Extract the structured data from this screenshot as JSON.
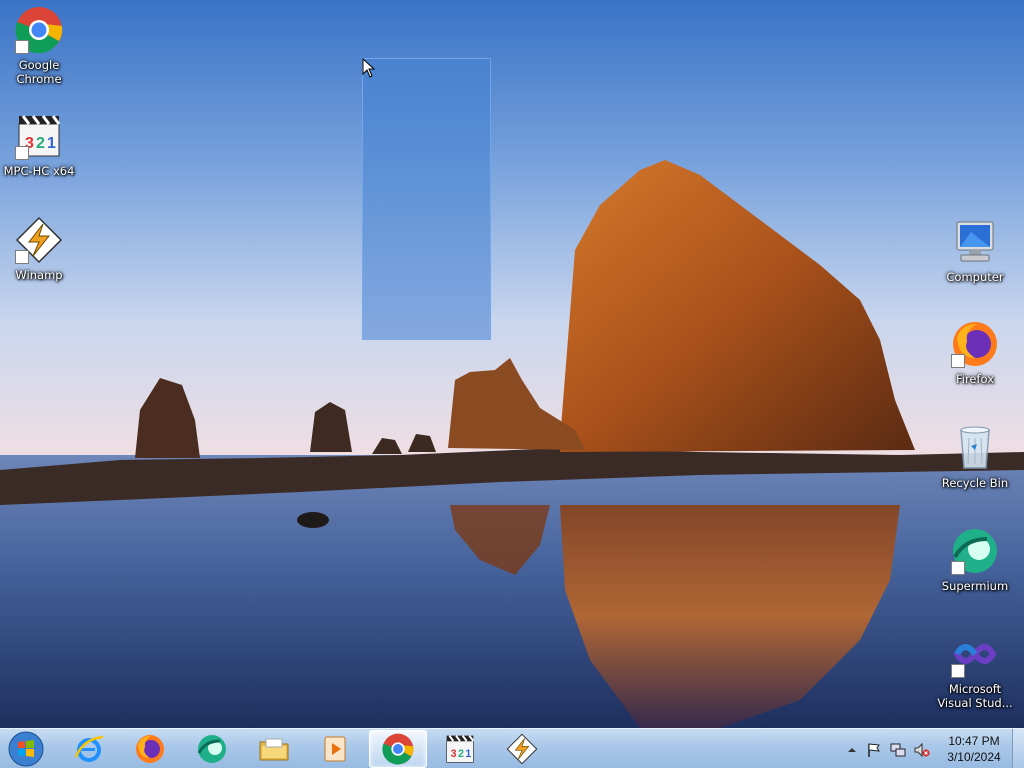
{
  "desktop": {
    "icons_left": [
      {
        "label": "Google Chrome",
        "icon": "chrome-icon"
      },
      {
        "label": "MPC-HC x64",
        "icon": "mpc-hc-icon"
      },
      {
        "label": "Winamp",
        "icon": "winamp-icon"
      }
    ],
    "icons_right": [
      {
        "label": "Computer",
        "icon": "computer-icon"
      },
      {
        "label": "Firefox",
        "icon": "firefox-icon"
      },
      {
        "label": "Recycle Bin",
        "icon": "recycle-bin-icon"
      },
      {
        "label": "Supermium",
        "icon": "supermium-icon"
      },
      {
        "label": "Microsoft Visual Stud...",
        "icon": "visual-studio-icon"
      }
    ]
  },
  "taskbar": {
    "start": {
      "icon": "windows-start-icon"
    },
    "pinned": [
      {
        "icon": "internet-explorer-icon"
      },
      {
        "icon": "firefox-icon"
      },
      {
        "icon": "supermium-icon"
      },
      {
        "icon": "file-explorer-icon"
      },
      {
        "icon": "media-player-icon"
      },
      {
        "icon": "chrome-icon",
        "active": true
      },
      {
        "icon": "mpc-hc-icon"
      },
      {
        "icon": "winamp-icon"
      }
    ],
    "tray": {
      "icons": [
        "show-hidden-icons-arrow",
        "action-center-flag-icon",
        "network-icon",
        "volume-muted-icon"
      ],
      "time": "10:47 PM",
      "date": "3/10/2024"
    }
  },
  "colors": {
    "sky_top": "#3f78c8",
    "sky_horizon": "#e9dde6",
    "rock": "#b85a1c",
    "selection": "#4682d2",
    "taskbar": "#a9c7e8"
  }
}
